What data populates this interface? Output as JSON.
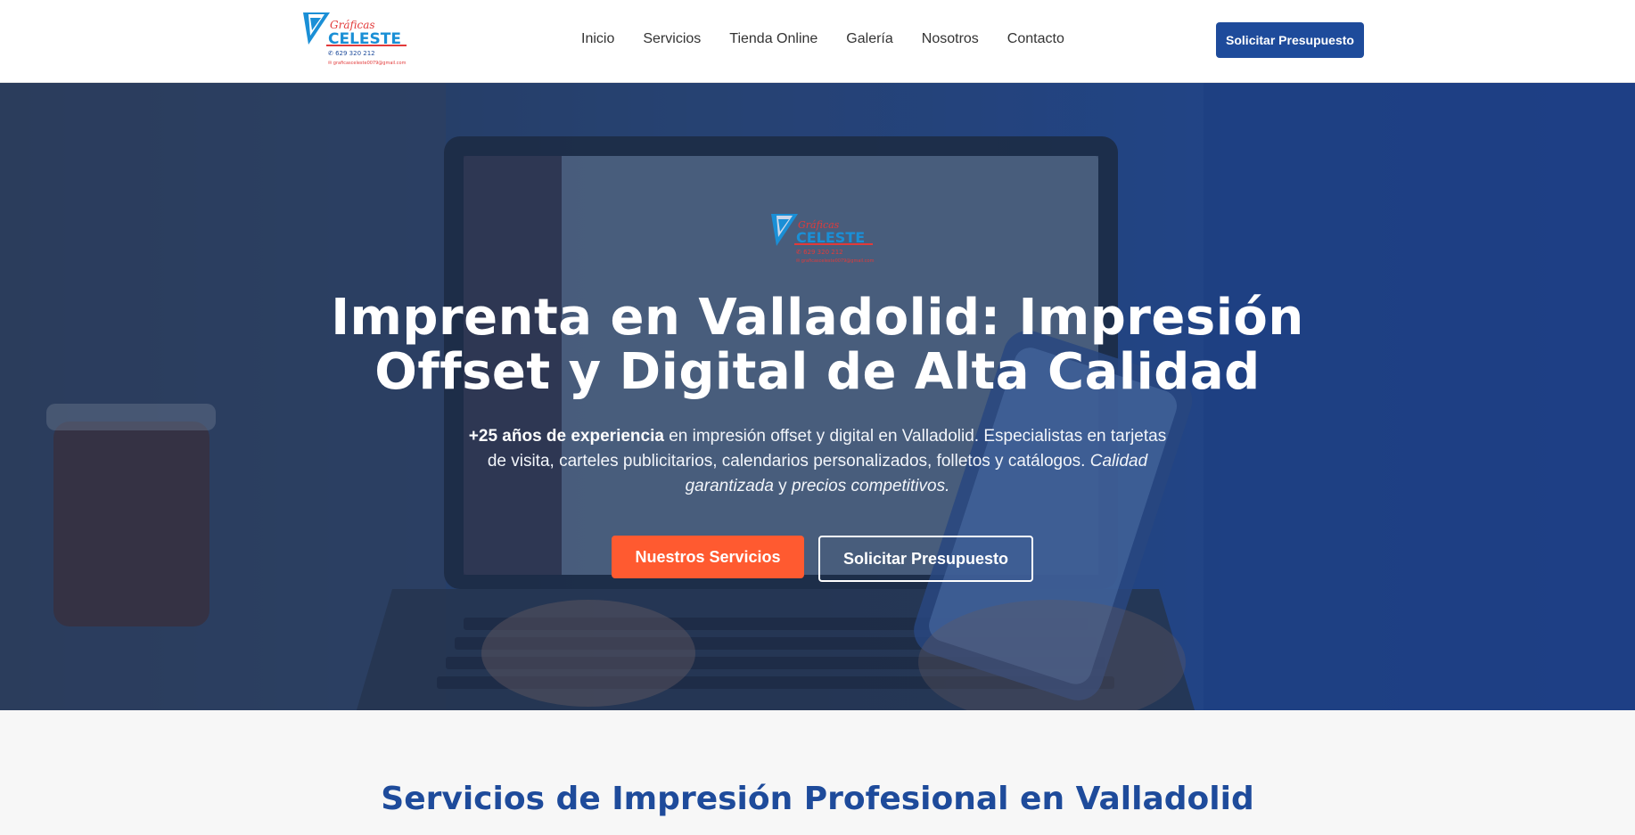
{
  "brand": {
    "logo_text_top": "Gráficas",
    "logo_text_main": "CELESTE",
    "logo_phone": "629 320 212",
    "logo_email": "graficasceleste0079@gmail.com",
    "colors": {
      "primary": "#1e4b9b",
      "accent": "#ff5a30",
      "logo_red": "#e23a3a",
      "logo_blue": "#1a8fd6"
    }
  },
  "nav": {
    "items": [
      "Inicio",
      "Servicios",
      "Tienda Online",
      "Galería",
      "Nosotros",
      "Contacto"
    ],
    "cta_label": "Solicitar Presupuesto"
  },
  "hero": {
    "title": "Imprenta en Valladolid: Impresión Offset y Digital de Alta Calidad",
    "sub_bold": "+25 años de experiencia",
    "sub_text": " en impresión offset y digital en Valladolid. Especialistas en tarjetas de visita, carteles publicitarios, calendarios personalizados, folletos y catálogos. ",
    "sub_italic_1": "Calidad garantizada",
    "sub_join": " y ",
    "sub_italic_2": "precios competitivos.",
    "btn_primary": "Nuestros Servicios",
    "btn_secondary": "Solicitar Presupuesto"
  },
  "services": {
    "title": "Servicios de Impresión Profesional en Valladolid"
  }
}
